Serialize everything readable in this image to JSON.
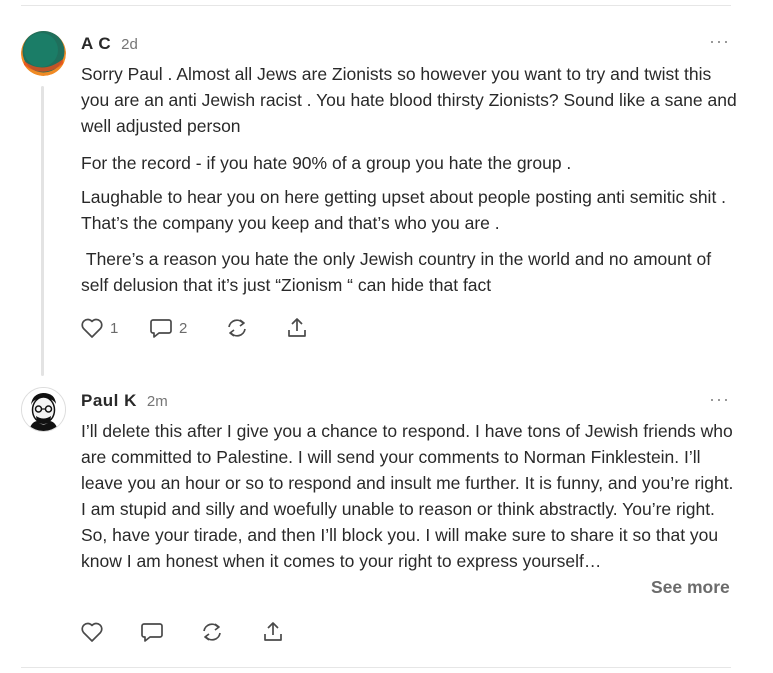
{
  "comments": [
    {
      "author": "A C",
      "time": "2d",
      "more": "···",
      "paragraphs": [
        "Sorry Paul . Almost all Jews are Zionists so however you want to try and twist this you are an anti Jewish racist . You hate blood thirsty Zionists? Sound like a sane and well adjusted person",
        "For the record - if you hate 90% of a group you hate the group .",
        "Laughable to hear you on here getting upset about people posting anti semitic shit .  That’s the company you keep and that’s who you are .",
        " There’s a reason you hate the only Jewish country in the world and no amount of self delusion that it’s just “Zionism “ can hide that fact"
      ],
      "likes": "1",
      "replies": "2"
    },
    {
      "author": "Paul K",
      "time": "2m",
      "more": "···",
      "paragraphs": [
        "I’ll delete this after I give you a chance to respond. I have tons of Jewish friends who are committed to Palestine. I will send your comments to Norman Finklestein. I’ll leave you an hour or so to respond and insult me further. It is funny, and you’re right. I am stupid and silly and woefully unable to reason or think abstractly. You’re right. So, have your tirade, and then I’ll block you. I will make sure to share it so that you know I am honest when it comes to your right to express yourself…"
      ],
      "see_more": "See more"
    }
  ]
}
